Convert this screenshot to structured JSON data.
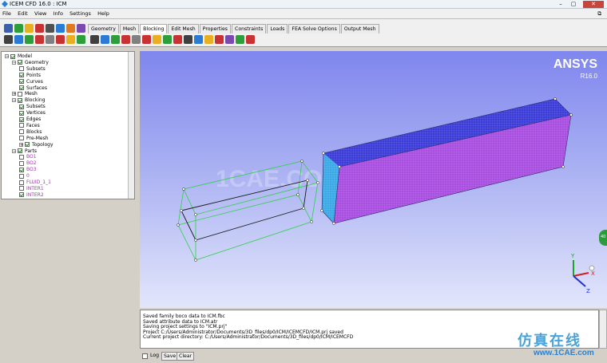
{
  "window": {
    "title": "ICEM CFD 16.0 : ICM",
    "minimize": "–",
    "maximize": "▢",
    "close": "✕",
    "restore": "⧉"
  },
  "menu": [
    "File",
    "Edit",
    "View",
    "Info",
    "Settings",
    "Help"
  ],
  "toolbar": {
    "tabs": [
      {
        "label": "Geometry"
      },
      {
        "label": "Mesh"
      },
      {
        "label": "Blocking",
        "active": true
      },
      {
        "label": "Edit Mesh"
      },
      {
        "label": "Properties"
      },
      {
        "label": "Constraints"
      },
      {
        "label": "Loads"
      },
      {
        "label": "FEA Solve Options"
      },
      {
        "label": "Output Mesh"
      }
    ],
    "icon_colors_row1": [
      "#3a5fb0",
      "#2e9e3a",
      "#e8b020",
      "#c83232",
      "#505050",
      "#2a7bd4",
      "#e07a20",
      "#7a4ab0"
    ],
    "icon_colors_row2": [
      "#404040",
      "#2a7bd4",
      "#2e9e3a",
      "#c83232",
      "#808080",
      "#c83232",
      "#e8b020",
      "#2e9e3a",
      "#c83232",
      "#404040",
      "#2a7bd4",
      "#e8b020",
      "#c83232",
      "#7a4ab0",
      "#2e9e3a",
      "#c83232"
    ]
  },
  "tree": [
    {
      "label": "Model",
      "level": 0,
      "checked": true,
      "expander": "−"
    },
    {
      "label": "Geometry",
      "level": 1,
      "checked": true,
      "expander": "−"
    },
    {
      "label": "Subsets",
      "level": 2,
      "checked": false
    },
    {
      "label": "Points",
      "level": 2,
      "checked": true
    },
    {
      "label": "Curves",
      "level": 2,
      "checked": true
    },
    {
      "label": "Surfaces",
      "level": 2,
      "checked": true
    },
    {
      "label": "Mesh",
      "level": 1,
      "checked": false,
      "expander": "+"
    },
    {
      "label": "Blocking",
      "level": 1,
      "checked": true,
      "expander": "−"
    },
    {
      "label": "Subsets",
      "level": 2,
      "checked": true
    },
    {
      "label": "Vertices",
      "level": 2,
      "checked": true
    },
    {
      "label": "Edges",
      "level": 2,
      "checked": true
    },
    {
      "label": "Faces",
      "level": 2,
      "checked": false
    },
    {
      "label": "Blocks",
      "level": 2,
      "checked": false
    },
    {
      "label": "Pre-Mesh",
      "level": 2,
      "checked": false
    },
    {
      "label": "Topology",
      "level": 2,
      "checked": true,
      "expander": "+"
    },
    {
      "label": "Parts",
      "level": 1,
      "checked": true,
      "expander": "−"
    },
    {
      "label": "BO1",
      "level": 2,
      "checked": false,
      "color": "#b030c0"
    },
    {
      "label": "BO2",
      "level": 2,
      "checked": false,
      "color": "#b030c0"
    },
    {
      "label": "BO3",
      "level": 2,
      "checked": true,
      "color": "#b030c0"
    },
    {
      "label": "0",
      "level": 2,
      "checked": false,
      "color": "#b030c0"
    },
    {
      "label": "FLUID_1_1",
      "level": 2,
      "checked": false,
      "color": "#b030c0"
    },
    {
      "label": "INTER1",
      "level": 2,
      "checked": false,
      "color": "#b030c0"
    },
    {
      "label": "INTER2",
      "level": 2,
      "checked": true,
      "color": "#b030c0"
    }
  ],
  "viewport": {
    "brand": "ANSYS",
    "version": "R16.0",
    "watermark": "1CAE.COM",
    "axis_labels": {
      "x": "X",
      "y": "Y",
      "z": "Z"
    },
    "side_badge": "40"
  },
  "messages": [
    "Saved family boco data to ICM.fbc",
    "Saved attribute data to ICM.atr",
    "Saving project settings to \"ICM.prj\"",
    "Project C:/Users/Administrator/Documents/3D_files/dp0/ICM/ICEMCFD/ICM.prj saved",
    "Current project directory: C:/Users/Administrator/Documents/3D_files/dp0/ICM/ICEMCFD"
  ],
  "bottom": {
    "log_label": "Log",
    "save_label": "Save",
    "clear_label": "Clear",
    "log_checked": false
  },
  "watermark": {
    "chinese": "仿真在线",
    "url": "www.1CAE.com"
  }
}
